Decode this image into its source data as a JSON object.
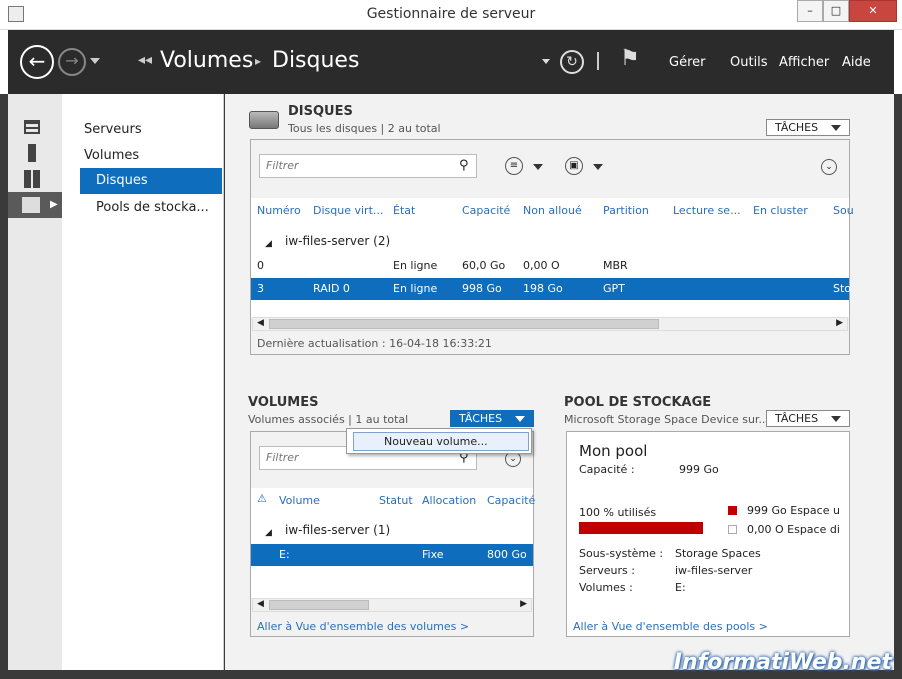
{
  "window": {
    "title": "Gestionnaire de serveur"
  },
  "header": {
    "breadcrumb_left": "Volumes",
    "breadcrumb_right": "Disques",
    "menus": [
      "Gérer",
      "Outils",
      "Afficher",
      "Aide"
    ]
  },
  "nav": {
    "items": [
      "Serveurs",
      "Volumes",
      "Disques",
      "Pools de stocka..."
    ],
    "selected": "Disques"
  },
  "disks": {
    "title": "DISQUES",
    "subtitle": "Tous les disques | 2 au total",
    "tasks": "TÂCHES",
    "filter_placeholder": "Filtrer",
    "columns": [
      "Numéro",
      "Disque virt...",
      "État",
      "Capacité",
      "Non alloué",
      "Partition",
      "Lecture se...",
      "En cluster",
      "Sou"
    ],
    "group": "iw-files-server (2)",
    "rows": [
      [
        "0",
        "",
        "En ligne",
        "60,0 Go",
        "0,00 O",
        "MBR",
        "",
        "",
        ""
      ],
      [
        "3",
        "RAID 0",
        "En ligne",
        "998 Go",
        "198 Go",
        "GPT",
        "",
        "",
        "Sto"
      ]
    ],
    "footer": "Dernière actualisation : 16-04-18 16:33:21"
  },
  "volumes": {
    "title": "VOLUMES",
    "subtitle": "Volumes associés | 1 au total",
    "tasks": "TÂCHES",
    "menu_item": "Nouveau volume...",
    "filter_placeholder": "Filtrer",
    "columns": [
      "Volume",
      "Statut",
      "Allocation",
      "Capacité"
    ],
    "group": "iw-files-server (1)",
    "rows": [
      [
        "E:",
        "",
        "Fixe",
        "800 Go"
      ]
    ],
    "link": "Aller à Vue d'ensemble des volumes >"
  },
  "pool": {
    "title": "POOL DE STOCKAGE",
    "subtitle": "Microsoft Storage Space Device sur...",
    "tasks": "TÂCHES",
    "name": "Mon pool",
    "capacity_label": "Capacité :",
    "capacity_value": "999 Go",
    "usage_text": "100 % utilisés",
    "usage_percent": 100,
    "legend_used": "999 Go Espace u",
    "legend_free": "0,00 O Espace di",
    "used_color": "#c00000",
    "subsystem_label": "Sous-système :",
    "subsystem_value": "Storage Spaces",
    "servers_label": "Serveurs :",
    "servers_value": "iw-files-server",
    "volumes_label": "Volumes :",
    "volumes_value": "E:",
    "link": "Aller à Vue d'ensemble des pools >"
  },
  "watermark": "InformatiWeb.net"
}
